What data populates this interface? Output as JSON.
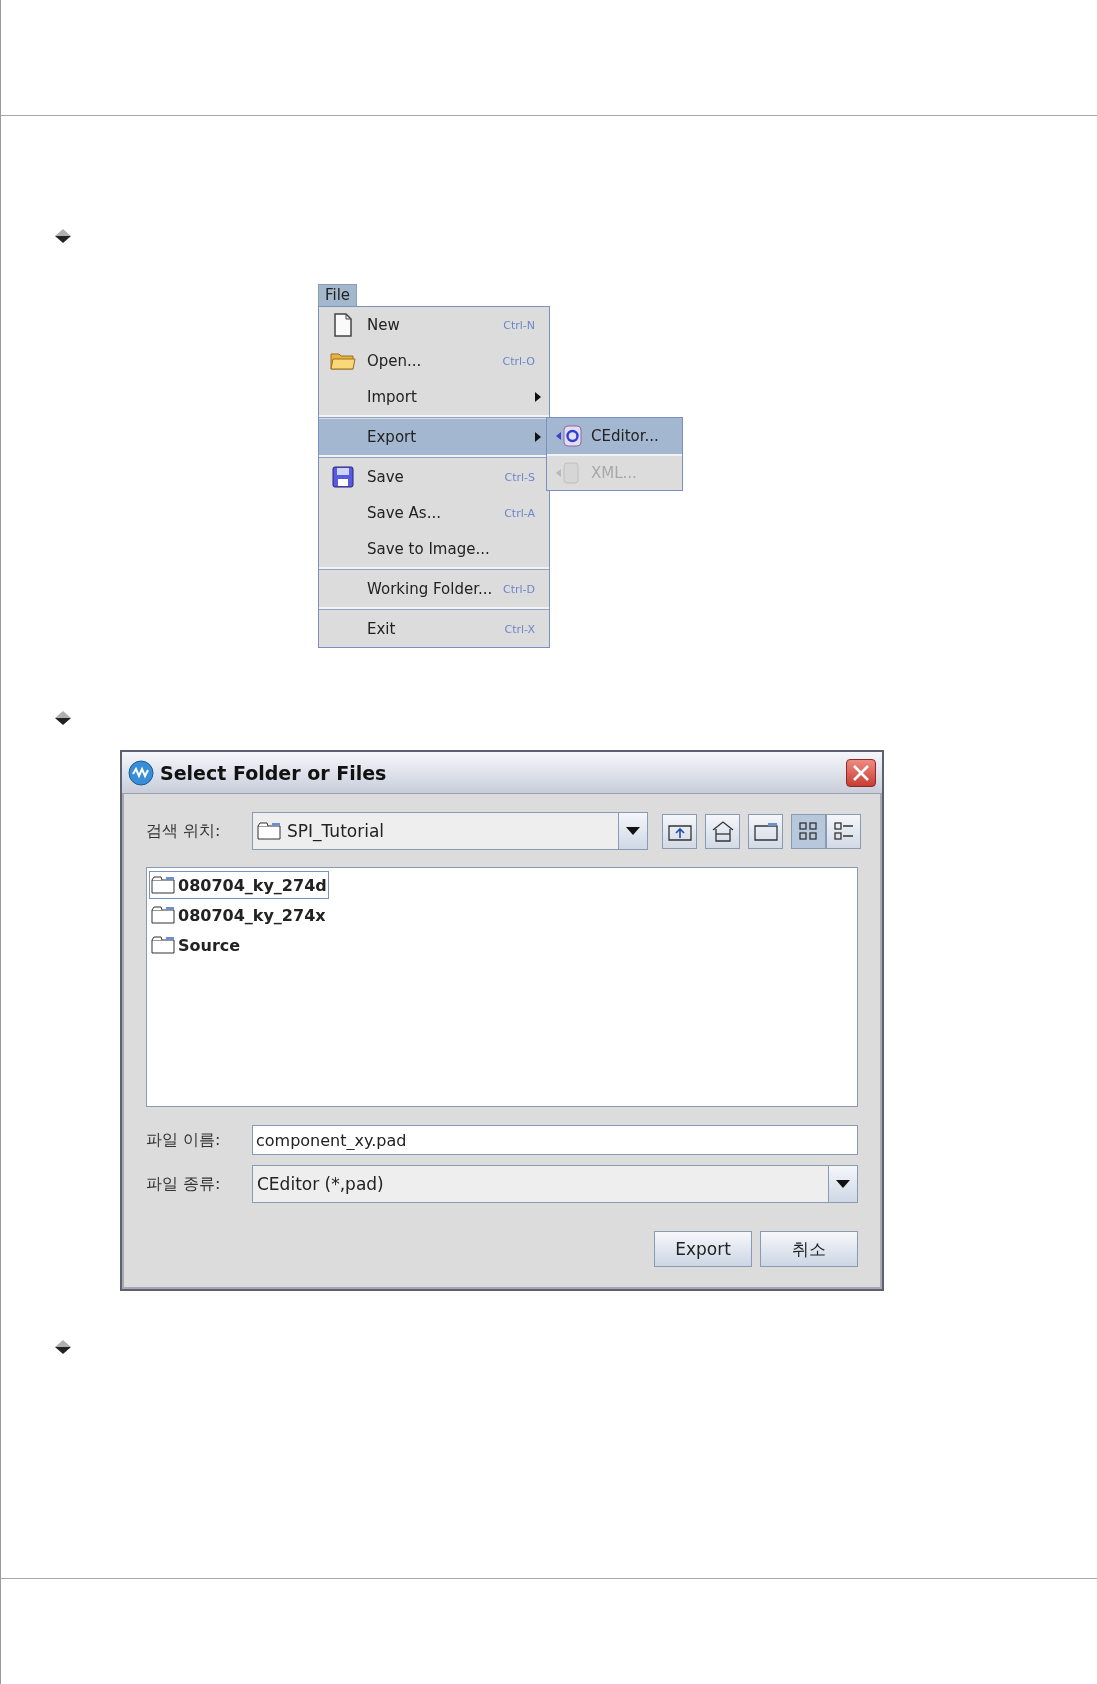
{
  "menu_bar": {
    "title": "File",
    "selected": true
  },
  "menu": {
    "groups": [
      {
        "items": [
          {
            "label": "New",
            "shortcut": "Ctrl-N",
            "kind": "document",
            "submenu": false,
            "selected": false
          },
          {
            "label": "Open...",
            "shortcut": "Ctrl-O",
            "kind": "folder",
            "submenu": false,
            "selected": false
          },
          {
            "label": "Import",
            "kind": "plain",
            "submenu": true,
            "selected": false
          }
        ]
      },
      {
        "items": [
          {
            "label": "Export",
            "kind": "plain",
            "submenu": true,
            "selected": true,
            "children": [
              {
                "label": "CEditor...",
                "kind": "export-g",
                "selected": true,
                "disabled": false
              },
              {
                "label": "XML...",
                "kind": "export-doc",
                "selected": false,
                "disabled": true
              }
            ]
          }
        ]
      },
      {
        "items": [
          {
            "label": "Save",
            "shortcut": "Ctrl-S",
            "kind": "floppy",
            "submenu": false,
            "selected": false
          },
          {
            "label": "Save As...",
            "shortcut": "Ctrl-A",
            "kind": "plain",
            "submenu": false,
            "selected": false
          },
          {
            "label": "Save to Image...",
            "kind": "plain",
            "submenu": false,
            "selected": false
          }
        ]
      },
      {
        "items": [
          {
            "label": "Working Folder...",
            "shortcut": "Ctrl-D",
            "kind": "plain",
            "submenu": false,
            "selected": false
          }
        ]
      },
      {
        "items": [
          {
            "label": "Exit",
            "shortcut": "Ctrl-X",
            "kind": "plain",
            "submenu": false,
            "selected": false
          }
        ]
      }
    ]
  },
  "dialog": {
    "title": "Select Folder or Files",
    "look_in": {
      "label": "검색 위치:",
      "value": "SPI_Tutorial"
    },
    "toolbar": [
      {
        "kind": "up-folder",
        "selected": false
      },
      {
        "kind": "home",
        "selected": false
      },
      {
        "kind": "new-folder",
        "selected": false
      },
      {
        "kind": "list-view",
        "selected": true
      },
      {
        "kind": "details-view",
        "selected": false
      }
    ],
    "files": [
      {
        "name": "080704_ky_274d",
        "selected": true
      },
      {
        "name": "080704_ky_274x",
        "selected": false
      },
      {
        "name": "Source",
        "selected": false
      }
    ],
    "file_name": {
      "label": "파일 이름:",
      "value": "component_xy.pad"
    },
    "file_type": {
      "label": "파일 종류:",
      "value": "CEditor (*,pad)"
    },
    "buttons": [
      "Export",
      "취소"
    ]
  }
}
